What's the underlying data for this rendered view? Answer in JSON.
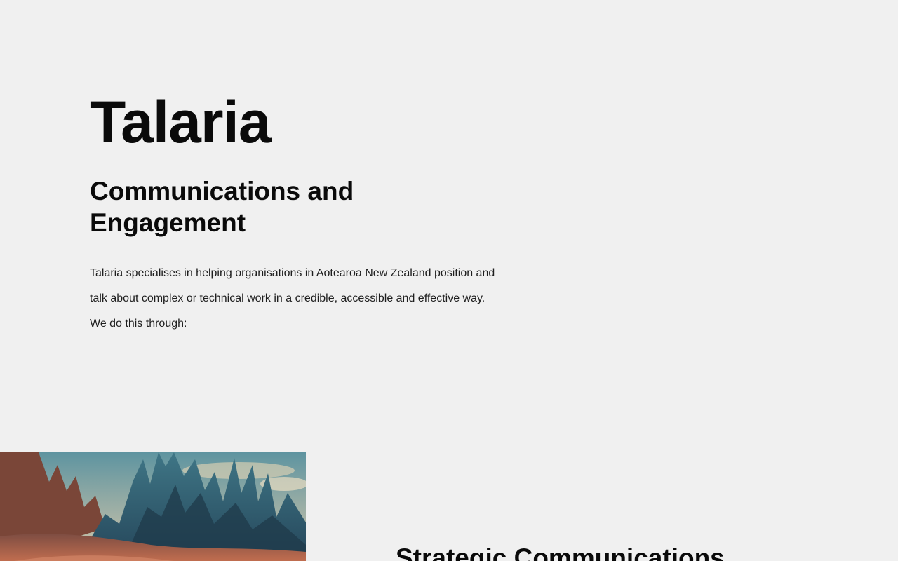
{
  "hero": {
    "brand": "Talaria",
    "subtitle": "Communications and Engagement",
    "intro_paragraph": "Talaria specialises in helping organisations in Aotearoa New Zealand position and talk about complex or technical work in a credible, accessible and effective way.",
    "intro_lead": "We do this through:"
  },
  "feature": {
    "image_icon": "landscape-image",
    "title": "Strategic Communications"
  },
  "colors": {
    "background": "#f0f0f0",
    "text": "#0a0a0a",
    "divider": "#dcdcdc"
  }
}
